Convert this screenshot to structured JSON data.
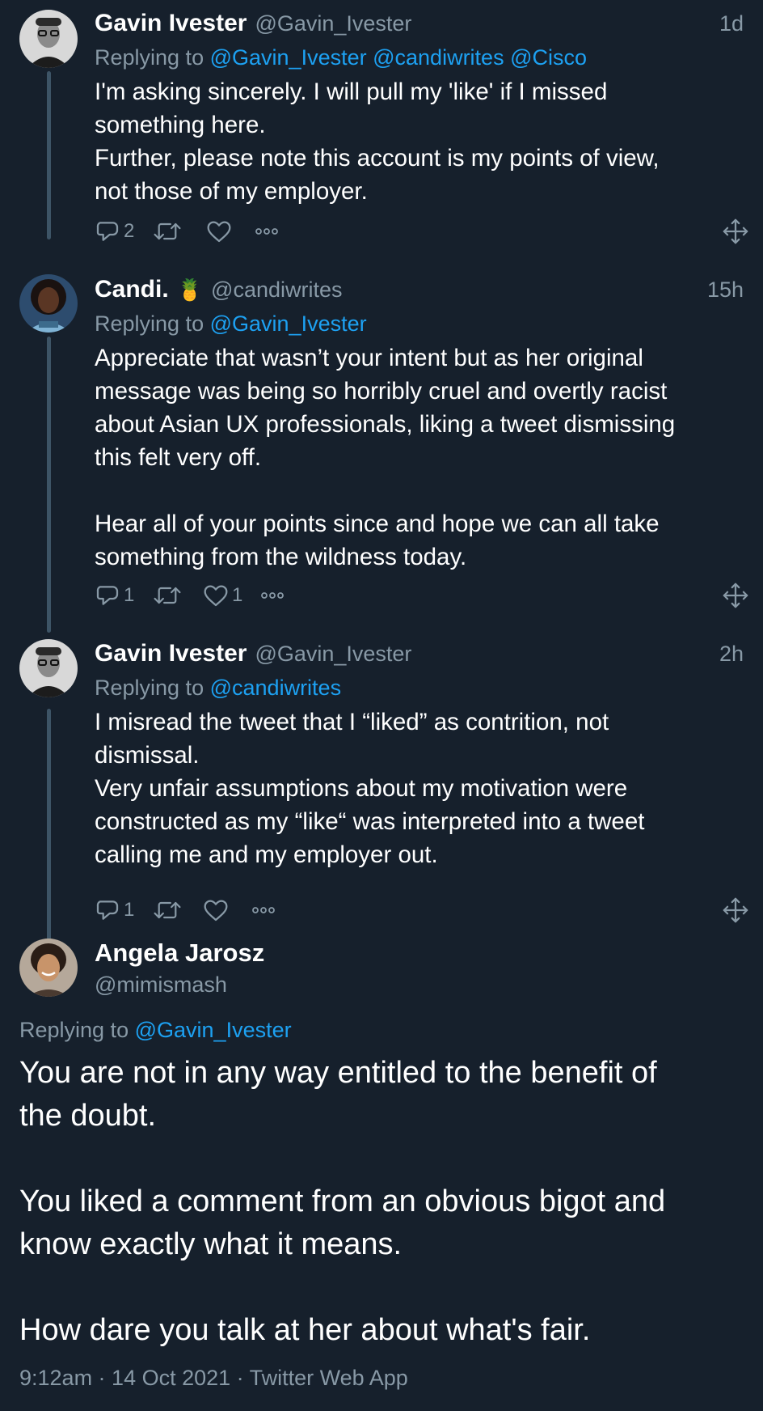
{
  "thread": [
    {
      "name": "Gavin Ivester",
      "handle": "@Gavin_Ivester",
      "time": "1d",
      "avatar_icon": "avatar-portrait-bw",
      "replying_label": "Replying to",
      "mentions": [
        "@Gavin_Ivester",
        "@candiwrites",
        "@Cisco"
      ],
      "lines": [
        "I'm asking sincerely. I will pull my 'like' if I missed",
        "something here.",
        "Further, please note this account is my points of view,",
        "not those of my employer."
      ],
      "reply_count": "2",
      "retweet_count": "",
      "like_count": ""
    },
    {
      "name": "Candi.",
      "emoji": "🍍",
      "handle": "@candiwrites",
      "time": "15h",
      "avatar_icon": "avatar-portrait-color",
      "replying_label": "Replying to",
      "mentions": [
        "@Gavin_Ivester"
      ],
      "lines": [
        "Appreciate that wasn’t your intent but as her original",
        "message was being so horribly cruel and overtly racist",
        "about Asian UX professionals, liking a tweet dismissing",
        "this felt very off.",
        "",
        "Hear all of your points since and hope we can all take",
        "something from the wildness today."
      ],
      "reply_count": "1",
      "retweet_count": "",
      "like_count": "1"
    },
    {
      "name": "Gavin Ivester",
      "handle": "@Gavin_Ivester",
      "time": "2h",
      "avatar_icon": "avatar-portrait-bw",
      "replying_label": "Replying to",
      "mentions": [
        "@candiwrites"
      ],
      "lines": [
        "I misread the tweet that I “liked” as contrition, not",
        "dismissal.",
        "Very unfair assumptions about my motivation were",
        "constructed as my “like“ was interpreted into a tweet",
        "calling me and my employer out."
      ],
      "reply_count": "1",
      "retweet_count": "",
      "like_count": ""
    }
  ],
  "main_tweet": {
    "name": "Angela Jarosz",
    "handle": "@mimismash",
    "avatar_icon": "avatar-portrait-color",
    "replying_label": "Replying to",
    "mention": "@Gavin_Ivester",
    "lines": [
      "You are not in any way entitled to the benefit of",
      "the doubt.",
      "",
      "You liked a comment from an obvious bigot and",
      "know exactly what it means.",
      "",
      "How dare you talk at her about what's fair."
    ],
    "meta": "9:12am · 14 Oct 2021 · Twitter Web App"
  },
  "colors": {
    "background": "#16202c",
    "text": "#ffffff",
    "secondary": "#8899a6",
    "link": "#1da1f2",
    "thread_line": "#3d5466"
  },
  "icons": [
    "reply-icon",
    "retweet-icon",
    "like-icon",
    "more-icon",
    "share-icon"
  ]
}
